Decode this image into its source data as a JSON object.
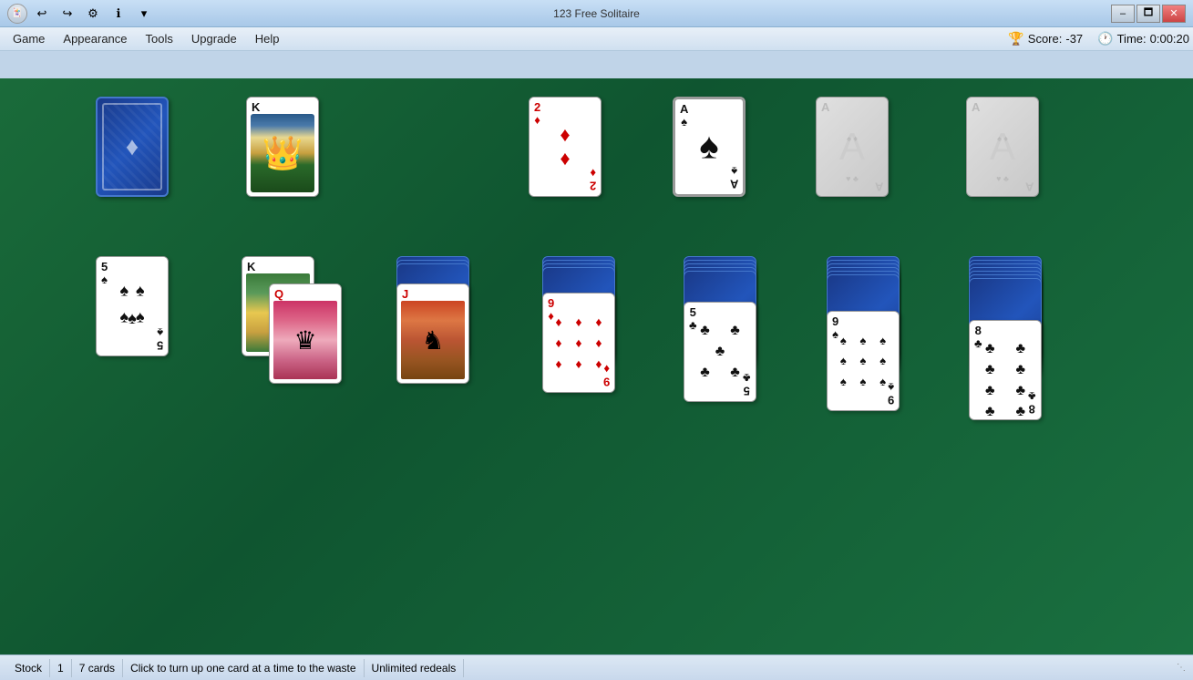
{
  "window": {
    "title": "123 Free Solitaire",
    "min_label": "–",
    "max_label": "🗖",
    "close_label": "✕"
  },
  "toolbar": {
    "icons": [
      "☰",
      "↩",
      "↪",
      "⚙",
      "ℹ",
      "▾"
    ]
  },
  "menu": {
    "items": [
      "Game",
      "Appearance",
      "Tools",
      "Upgrade",
      "Help"
    ]
  },
  "score": {
    "label": "Score:",
    "value": "-37",
    "time_label": "Time:",
    "time_value": "0:00:20"
  },
  "status": {
    "section1": "Stock",
    "section2": "1",
    "section3": "7 cards",
    "section4": "Click to turn up one card at a time to the waste",
    "section5": "Unlimited redeals"
  }
}
